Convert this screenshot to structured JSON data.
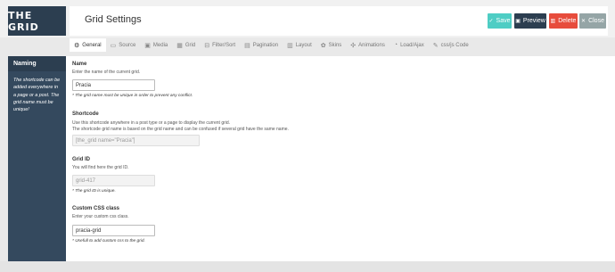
{
  "logo": {
    "text": "THE GRID"
  },
  "header": {
    "title": "Grid Settings",
    "buttons": {
      "save": "Save",
      "preview": "Preview",
      "delete": "Delete",
      "close": "Close"
    }
  },
  "tabs": [
    {
      "label": "General",
      "icon": "gear-icon",
      "glyph": "⚙"
    },
    {
      "label": "Source",
      "icon": "folder-icon",
      "glyph": "▭"
    },
    {
      "label": "Media",
      "icon": "image-icon",
      "glyph": "▣"
    },
    {
      "label": "Grid",
      "icon": "grid-icon",
      "glyph": "▦"
    },
    {
      "label": "Filter/Sort",
      "icon": "filter-icon",
      "glyph": "⊟"
    },
    {
      "label": "Pagination",
      "icon": "pagination-icon",
      "glyph": "▤"
    },
    {
      "label": "Layout",
      "icon": "layout-icon",
      "glyph": "▥"
    },
    {
      "label": "Skins",
      "icon": "skins-icon",
      "glyph": "✿"
    },
    {
      "label": "Animations",
      "icon": "animations-icon",
      "glyph": "✣"
    },
    {
      "label": "Load/Ajax",
      "icon": "load-icon",
      "glyph": "◔"
    },
    {
      "label": "css/js Code",
      "icon": "wrench-icon",
      "glyph": "✎"
    }
  ],
  "sidebar": {
    "title": "Naming",
    "text": "The shortcode can be added everywhere in a page or a post. The grid name must be unique!"
  },
  "sections": {
    "name": {
      "label": "Name",
      "desc": "Enter the name of the current grid.",
      "value": "Pracia",
      "hint": "* The grid name must be unique in order to prevent any conflict."
    },
    "shortcode": {
      "label": "Shortcode",
      "desc1": "Use this shortcode anywhere in a post type or a page to display the current grid.",
      "desc2": "The shortcode grid name is based on the grid name and can be confused if several grid have the same name.",
      "value": "[the_grid name=\"Pracia\"]"
    },
    "grid_id": {
      "label": "Grid ID",
      "desc": "You will find here the grid ID.",
      "value": "grid-417",
      "hint": "* The grid ID is unique."
    },
    "css_class": {
      "label": "Custom CSS class",
      "desc": "Enter your custom css class.",
      "value": "pracia-grid",
      "hint": "* Usefull to add custom css to the grid."
    }
  }
}
